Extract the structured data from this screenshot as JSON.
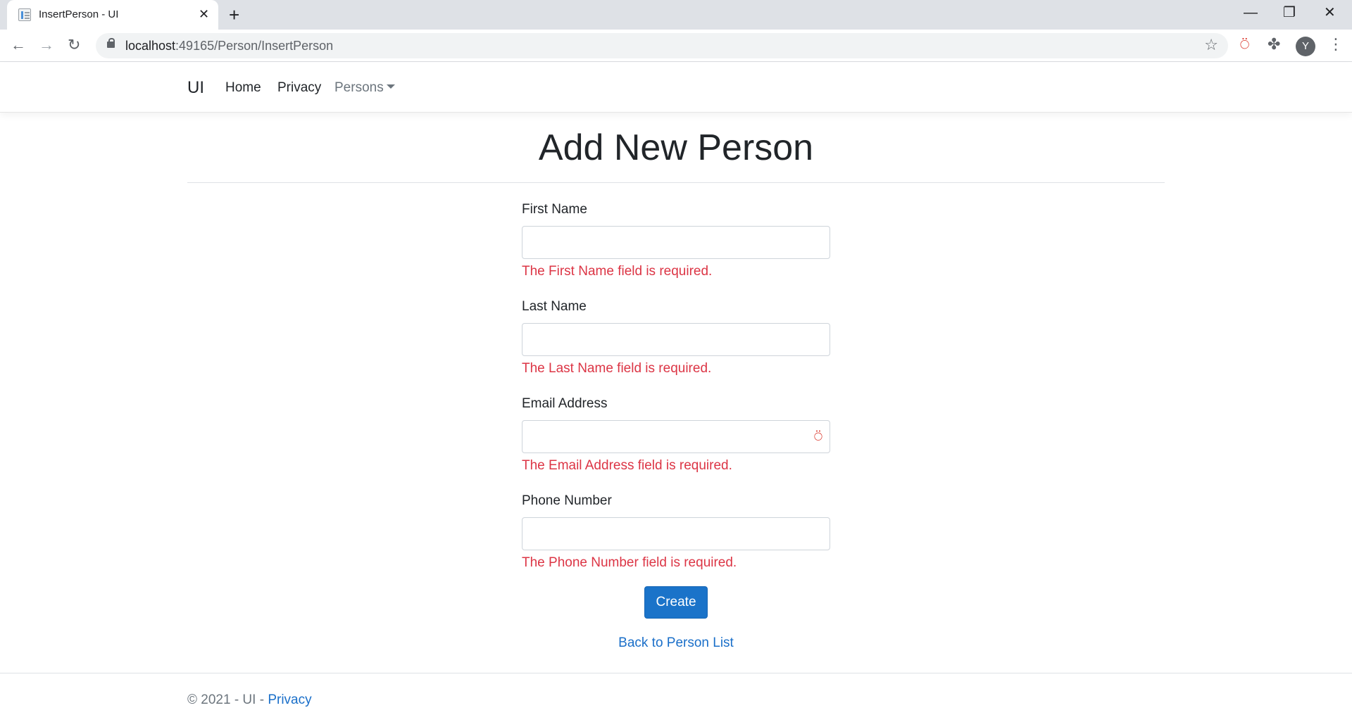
{
  "browser": {
    "tab_title": "InsertPerson - UI",
    "tab_close": "✕",
    "new_tab": "+",
    "url_host": "localhost",
    "url_rest": ":49165/Person/InsertPerson",
    "avatar_letter": "Y",
    "controls": {
      "minimize": "—",
      "restore": "❐",
      "close": "✕"
    },
    "nav": {
      "back": "←",
      "forward": "→",
      "reload": "↻"
    },
    "icons": {
      "star": "☆",
      "extension_red": "⍥",
      "puzzle": "✤",
      "menu": "⋮"
    }
  },
  "navbar": {
    "brand": "UI",
    "links": [
      "Home",
      "Privacy"
    ],
    "dropdown": "Persons"
  },
  "page": {
    "title": "Add New Person",
    "fields": [
      {
        "label": "First Name",
        "value": "",
        "error": "The First Name field is required."
      },
      {
        "label": "Last Name",
        "value": "",
        "error": "The Last Name field is required."
      },
      {
        "label": "Email Address",
        "value": "",
        "error": "The Email Address field is required."
      },
      {
        "label": "Phone Number",
        "value": "",
        "error": "The Phone Number field is required."
      }
    ],
    "submit_label": "Create",
    "back_link": "Back to Person List"
  },
  "footer": {
    "text": "© 2021 - UI - ",
    "link": "Privacy"
  },
  "colors": {
    "error": "#dc3545",
    "primary": "#1a73c9",
    "link": "#1a6fc9"
  }
}
